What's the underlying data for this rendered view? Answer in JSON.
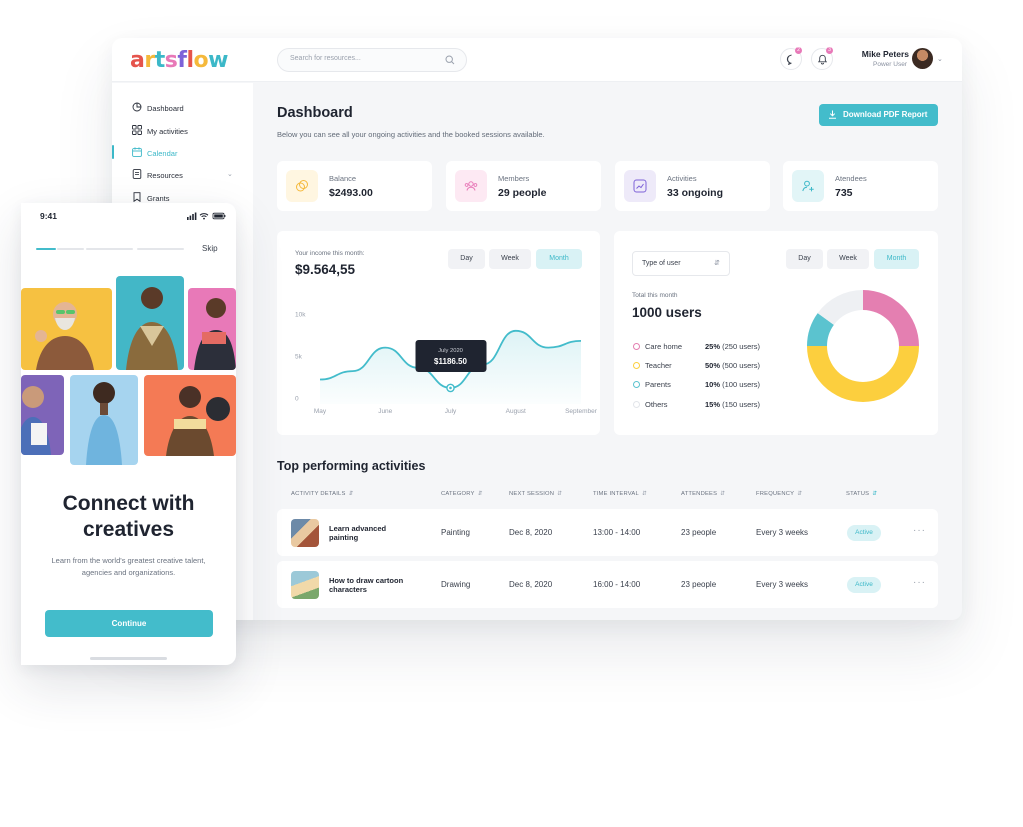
{
  "brand": {
    "logo_letters": [
      "a",
      "r",
      "t",
      "s",
      "f",
      "l",
      "o",
      "w"
    ],
    "logo_colors": [
      "#e5544c",
      "#f5b93b",
      "#3cb8c8",
      "#e879b8",
      "#7d62d8",
      "#e5544c",
      "#f5b93b",
      "#3cb8c8"
    ],
    "accent": "#43bccb"
  },
  "search": {
    "placeholder": "Search for resources..."
  },
  "header": {
    "messages_badge": "2",
    "notifications_badge": "3",
    "user_name": "Mike Peters",
    "user_role": "Power User"
  },
  "sidebar": {
    "items": [
      {
        "label": "Dashboard",
        "icon": "dashboard-icon"
      },
      {
        "label": "My activities",
        "icon": "grid-icon"
      },
      {
        "label": "Calendar",
        "icon": "calendar-icon",
        "active": true
      },
      {
        "label": "Resources",
        "icon": "document-icon",
        "expandable": true
      },
      {
        "label": "Grants",
        "icon": "bookmark-icon"
      }
    ]
  },
  "dashboard": {
    "title": "Dashboard",
    "subtitle": "Below you can see all your ongoing activities and the booked sessions available.",
    "pdf_button": "Download PDF Report"
  },
  "stats": [
    {
      "label": "Balance",
      "value": "$2493.00",
      "icon": "coins-icon",
      "color": "#f5b93b"
    },
    {
      "label": "Members",
      "value": "29 people",
      "icon": "group-icon",
      "color": "#e879b8"
    },
    {
      "label": "Activities",
      "value": "33 ongoing",
      "icon": "activity-icon",
      "color": "#7d62d8"
    },
    {
      "label": "Atendees",
      "value": "735",
      "icon": "user-plus-icon",
      "color": "#3cb8c8"
    }
  ],
  "range_options": [
    "Day",
    "Week",
    "Month"
  ],
  "range_selected": "Month",
  "income": {
    "label": "Your income this month:",
    "value": "$9.564,55",
    "tooltip_date": "July 2020",
    "tooltip_value": "$1186.50"
  },
  "users": {
    "select_label": "Type of user",
    "total_label": "Total this month",
    "total_value": "1000 users",
    "segments": [
      {
        "name": "Care home",
        "percent": "25%",
        "count": "(250 users)",
        "color": "#e47fb1"
      },
      {
        "name": "Teacher",
        "percent": "50%",
        "count": "(500 users)",
        "color": "#fccf3e"
      },
      {
        "name": "Parents",
        "percent": "10%",
        "count": "(100 users)",
        "color": "#5bc3cf"
      },
      {
        "name": "Others",
        "percent": "15%",
        "count": "(150 users)",
        "color": "#eef0f3"
      }
    ]
  },
  "chart_data": [
    {
      "type": "line",
      "ylabel": "",
      "xlabel": "",
      "y_ticks": [
        "10k",
        "5k",
        "0"
      ],
      "ylim": [
        0,
        10000
      ],
      "x_ticks": [
        "May",
        "June",
        "July",
        "August",
        "September"
      ],
      "x": [
        0,
        0.5,
        1,
        1.5,
        2,
        2.5,
        3,
        3.5,
        4
      ],
      "y": [
        2200,
        3200,
        6000,
        3600,
        1200,
        4000,
        8000,
        6000,
        6800
      ],
      "highlight": {
        "x": 2,
        "label": "July 2020",
        "value": "$1186.50"
      },
      "grid": false
    },
    {
      "type": "pie",
      "categories": [
        "Care home",
        "Teacher",
        "Parents",
        "Others"
      ],
      "values": [
        25,
        50,
        10,
        15
      ],
      "title": "1000 users"
    }
  ],
  "activities": {
    "title": "Top performing activities",
    "columns": [
      "ACTIVITY DETAILS",
      "CATEGORY",
      "NEXT SESSION",
      "TIME INTERVAL",
      "ATTENDEES",
      "FREQUENCY",
      "STATUS"
    ],
    "rows": [
      {
        "name": "Learn advanced painting",
        "category": "Painting",
        "next": "Dec 8, 2020",
        "interval": "13:00 - 14:00",
        "attendees": "23 people",
        "frequency": "Every 3 weeks",
        "status": "Active"
      },
      {
        "name": "How to draw cartoon characters",
        "category": "Drawing",
        "next": "Dec 8, 2020",
        "interval": "16:00 - 14:00",
        "attendees": "23 people",
        "frequency": "Every 3 weeks",
        "status": "Active"
      }
    ]
  },
  "phone": {
    "time": "9:41",
    "skip": "Skip",
    "title_line1": "Connect with",
    "title_line2": "creatives",
    "subtitle": "Learn from the world's greatest creative talent, agencies and organizations.",
    "button": "Continue",
    "progress_step": 1,
    "progress_total": 3
  }
}
